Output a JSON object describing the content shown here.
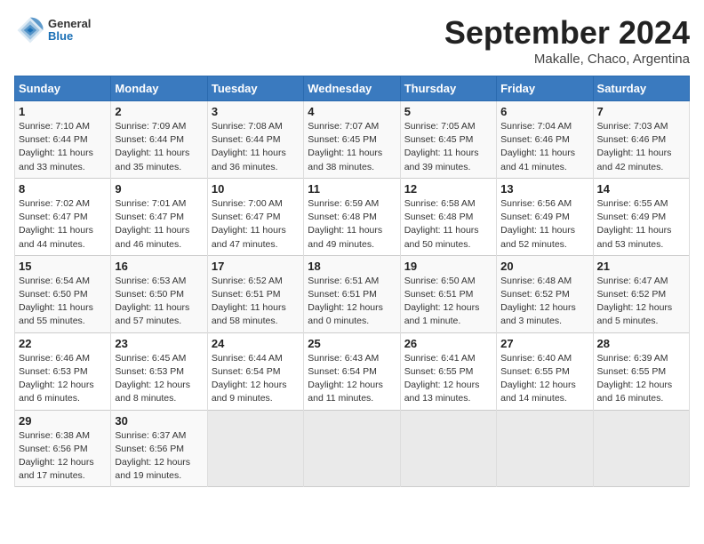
{
  "header": {
    "logo": {
      "general": "General",
      "blue": "Blue"
    },
    "month": "September 2024",
    "location": "Makalle, Chaco, Argentina"
  },
  "weekdays": [
    "Sunday",
    "Monday",
    "Tuesday",
    "Wednesday",
    "Thursday",
    "Friday",
    "Saturday"
  ],
  "weeks": [
    [
      {
        "day": "1",
        "sunrise": "7:10 AM",
        "sunset": "6:44 PM",
        "daylight": "11 hours and 33 minutes."
      },
      {
        "day": "2",
        "sunrise": "7:09 AM",
        "sunset": "6:44 PM",
        "daylight": "11 hours and 35 minutes."
      },
      {
        "day": "3",
        "sunrise": "7:08 AM",
        "sunset": "6:44 PM",
        "daylight": "11 hours and 36 minutes."
      },
      {
        "day": "4",
        "sunrise": "7:07 AM",
        "sunset": "6:45 PM",
        "daylight": "11 hours and 38 minutes."
      },
      {
        "day": "5",
        "sunrise": "7:05 AM",
        "sunset": "6:45 PM",
        "daylight": "11 hours and 39 minutes."
      },
      {
        "day": "6",
        "sunrise": "7:04 AM",
        "sunset": "6:46 PM",
        "daylight": "11 hours and 41 minutes."
      },
      {
        "day": "7",
        "sunrise": "7:03 AM",
        "sunset": "6:46 PM",
        "daylight": "11 hours and 42 minutes."
      }
    ],
    [
      {
        "day": "8",
        "sunrise": "7:02 AM",
        "sunset": "6:47 PM",
        "daylight": "11 hours and 44 minutes."
      },
      {
        "day": "9",
        "sunrise": "7:01 AM",
        "sunset": "6:47 PM",
        "daylight": "11 hours and 46 minutes."
      },
      {
        "day": "10",
        "sunrise": "7:00 AM",
        "sunset": "6:47 PM",
        "daylight": "11 hours and 47 minutes."
      },
      {
        "day": "11",
        "sunrise": "6:59 AM",
        "sunset": "6:48 PM",
        "daylight": "11 hours and 49 minutes."
      },
      {
        "day": "12",
        "sunrise": "6:58 AM",
        "sunset": "6:48 PM",
        "daylight": "11 hours and 50 minutes."
      },
      {
        "day": "13",
        "sunrise": "6:56 AM",
        "sunset": "6:49 PM",
        "daylight": "11 hours and 52 minutes."
      },
      {
        "day": "14",
        "sunrise": "6:55 AM",
        "sunset": "6:49 PM",
        "daylight": "11 hours and 53 minutes."
      }
    ],
    [
      {
        "day": "15",
        "sunrise": "6:54 AM",
        "sunset": "6:50 PM",
        "daylight": "11 hours and 55 minutes."
      },
      {
        "day": "16",
        "sunrise": "6:53 AM",
        "sunset": "6:50 PM",
        "daylight": "11 hours and 57 minutes."
      },
      {
        "day": "17",
        "sunrise": "6:52 AM",
        "sunset": "6:51 PM",
        "daylight": "11 hours and 58 minutes."
      },
      {
        "day": "18",
        "sunrise": "6:51 AM",
        "sunset": "6:51 PM",
        "daylight": "12 hours and 0 minutes."
      },
      {
        "day": "19",
        "sunrise": "6:50 AM",
        "sunset": "6:51 PM",
        "daylight": "12 hours and 1 minute."
      },
      {
        "day": "20",
        "sunrise": "6:48 AM",
        "sunset": "6:52 PM",
        "daylight": "12 hours and 3 minutes."
      },
      {
        "day": "21",
        "sunrise": "6:47 AM",
        "sunset": "6:52 PM",
        "daylight": "12 hours and 5 minutes."
      }
    ],
    [
      {
        "day": "22",
        "sunrise": "6:46 AM",
        "sunset": "6:53 PM",
        "daylight": "12 hours and 6 minutes."
      },
      {
        "day": "23",
        "sunrise": "6:45 AM",
        "sunset": "6:53 PM",
        "daylight": "12 hours and 8 minutes."
      },
      {
        "day": "24",
        "sunrise": "6:44 AM",
        "sunset": "6:54 PM",
        "daylight": "12 hours and 9 minutes."
      },
      {
        "day": "25",
        "sunrise": "6:43 AM",
        "sunset": "6:54 PM",
        "daylight": "12 hours and 11 minutes."
      },
      {
        "day": "26",
        "sunrise": "6:41 AM",
        "sunset": "6:55 PM",
        "daylight": "12 hours and 13 minutes."
      },
      {
        "day": "27",
        "sunrise": "6:40 AM",
        "sunset": "6:55 PM",
        "daylight": "12 hours and 14 minutes."
      },
      {
        "day": "28",
        "sunrise": "6:39 AM",
        "sunset": "6:55 PM",
        "daylight": "12 hours and 16 minutes."
      }
    ],
    [
      {
        "day": "29",
        "sunrise": "6:38 AM",
        "sunset": "6:56 PM",
        "daylight": "12 hours and 17 minutes."
      },
      {
        "day": "30",
        "sunrise": "6:37 AM",
        "sunset": "6:56 PM",
        "daylight": "12 hours and 19 minutes."
      },
      null,
      null,
      null,
      null,
      null
    ]
  ]
}
